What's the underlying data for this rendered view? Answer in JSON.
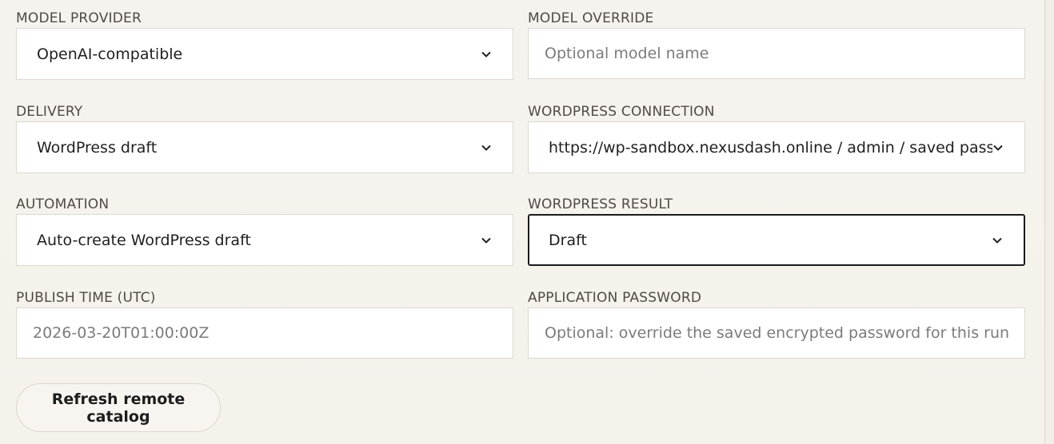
{
  "fields": {
    "model_provider": {
      "label": "MODEL PROVIDER",
      "value": "OpenAI-compatible"
    },
    "model_override": {
      "label": "MODEL OVERRIDE",
      "placeholder": "Optional model name"
    },
    "delivery": {
      "label": "DELIVERY",
      "value": "WordPress draft"
    },
    "wordpress_connection": {
      "label": "WORDPRESS CONNECTION",
      "value": "https://wp-sandbox.nexusdash.online / admin / saved password"
    },
    "automation": {
      "label": "AUTOMATION",
      "value": "Auto-create WordPress draft"
    },
    "wordpress_result": {
      "label": "WORDPRESS RESULT",
      "value": "Draft"
    },
    "publish_time": {
      "label": "PUBLISH TIME (UTC)",
      "placeholder": "2026-03-20T01:00:00Z"
    },
    "application_password": {
      "label": "APPLICATION PASSWORD",
      "placeholder": "Optional: override the saved encrypted password for this run"
    }
  },
  "actions": {
    "refresh_label": "Refresh remote catalog"
  },
  "icons": {
    "select_indicator": "chevron-down-icon"
  },
  "colors": {
    "background": "#f7f4ef",
    "field_background": "#ffffff",
    "field_border": "#ddd8d1",
    "focus_border": "#1b1b1b",
    "label_text": "#4f4a45",
    "placeholder_text": "#7b7b7b"
  }
}
